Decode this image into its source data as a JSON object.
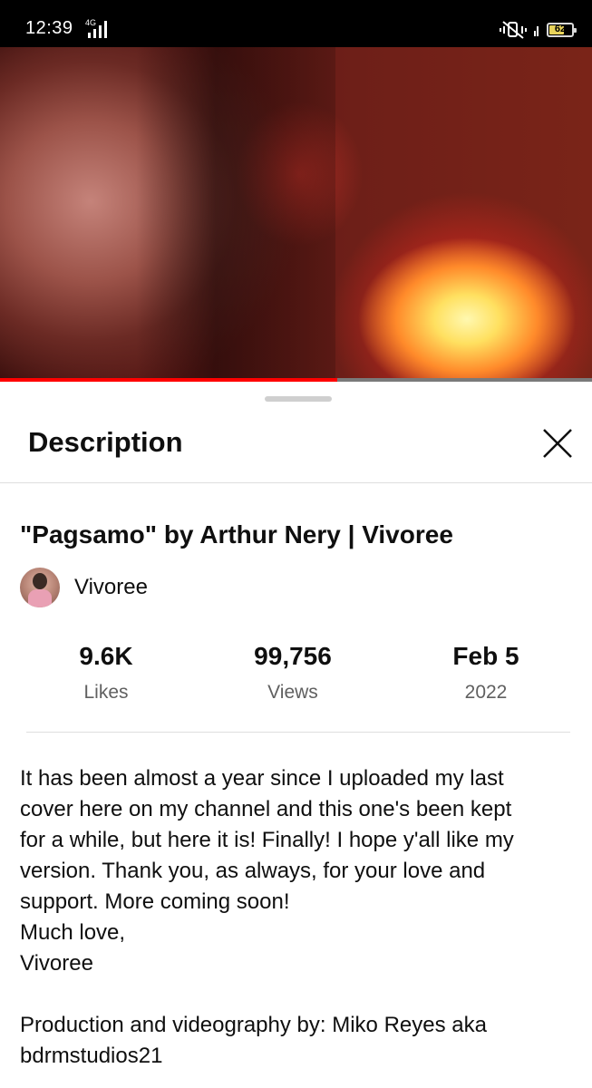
{
  "status_bar": {
    "time": "12:39",
    "network": "4G",
    "battery": "62"
  },
  "video": {
    "progress_fraction": 0.57
  },
  "sheet": {
    "title": "Description",
    "video_title": "\"Pagsamo\" by Arthur Nery | Vivoree",
    "channel_name": "Vivoree",
    "stats": [
      {
        "value": "9.6K",
        "label": "Likes"
      },
      {
        "value": "99,756",
        "label": "Views"
      },
      {
        "value": "Feb 5",
        "label": "2022"
      }
    ],
    "description": {
      "line1": "It has been almost a year since I uploaded my last",
      "line2": "cover here on my channel and this one's been kept",
      "line3": "for a while, but here it is! Finally! I hope y'all like my",
      "line4": "version. Thank you, as always, for your love and",
      "line5": "support. More coming soon!",
      "line6": "Much love,",
      "line7": "Vivoree",
      "line8": "Production and videography by: Miko Reyes aka",
      "line9": "bdrmstudios21"
    }
  },
  "colors": {
    "progress": "#ff0000",
    "text": "#0f0f0f",
    "muted": "#606060"
  }
}
